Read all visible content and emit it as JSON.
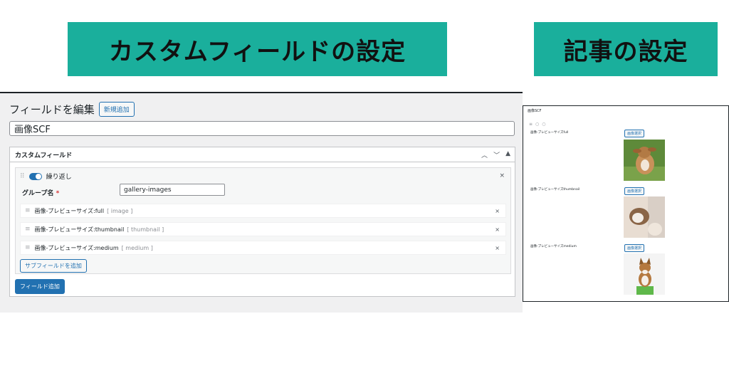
{
  "banners": {
    "left": "カスタムフィールドの設定",
    "right": "記事の設定"
  },
  "editor": {
    "heading": "フィールドを編集",
    "new_button": "新規追加",
    "title_value": "画像SCF",
    "metabox_title": "カスタムフィールド",
    "repeat_label": "繰り返し",
    "group_label": "グループ名",
    "required_mark": "*",
    "group_value": "gallery-images",
    "subfields": [
      {
        "label": "画像-プレビューサイズ:full",
        "type": "[ image ]"
      },
      {
        "label": "画像-プレビューサイズ:thumbnail",
        "type": "[ thumbnail ]"
      },
      {
        "label": "画像-プレビューサイズ:medium",
        "type": "[ medium ]"
      }
    ],
    "add_subfield": "サブフィールドを追加",
    "add_field": "フィールド追加",
    "close_glyph": "×"
  },
  "preview": {
    "title": "画像SCF",
    "items": [
      {
        "label": "画像-プレビューサイズfull",
        "button": "画像選択"
      },
      {
        "label": "画像-プレビューサイズthumbnail",
        "button": "画像選択"
      },
      {
        "label": "画像-プレビューサイズmedium",
        "button": "画像選択"
      }
    ]
  },
  "colors": {
    "accent": "#1aaf9c",
    "wp_blue": "#2271b1"
  }
}
